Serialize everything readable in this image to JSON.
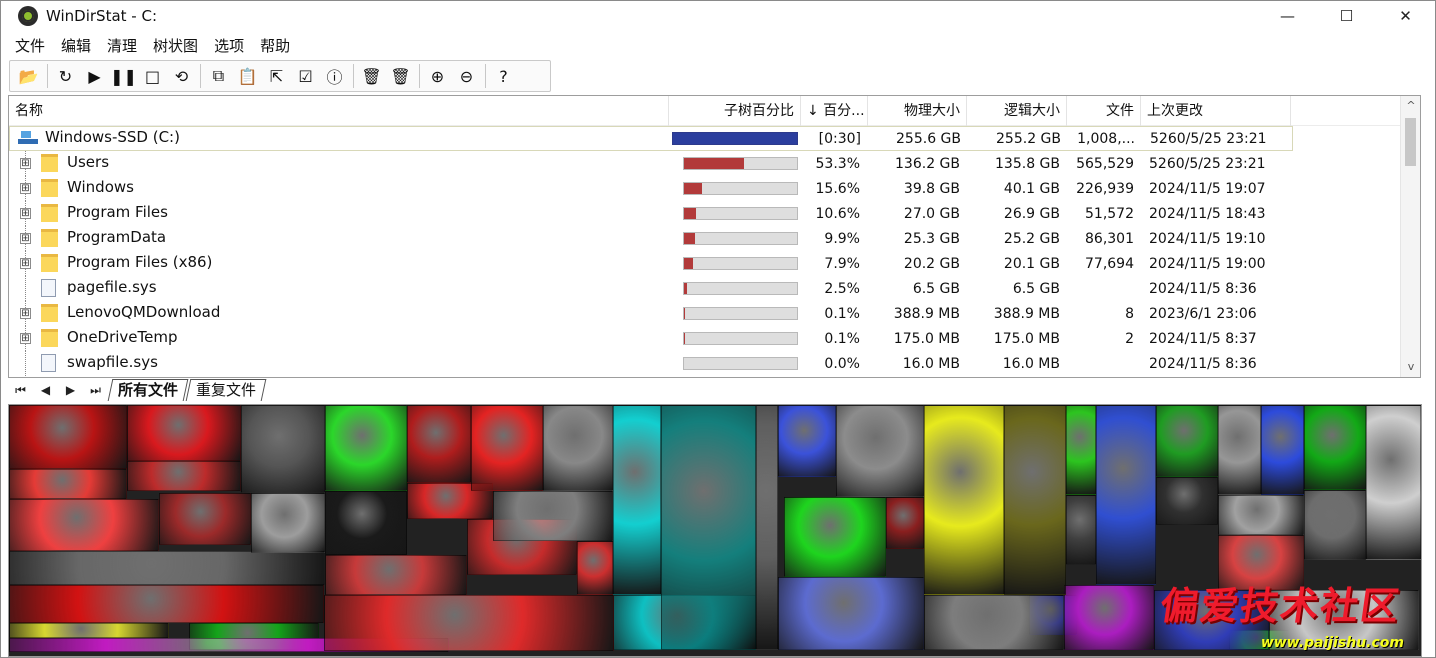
{
  "window": {
    "title": "WinDirStat - C:",
    "minimize": "—",
    "maximize": "☐",
    "close": "✕"
  },
  "menu": [
    "文件",
    "编辑",
    "清理",
    "树状图",
    "选项",
    "帮助"
  ],
  "toolbar": [
    {
      "name": "open-icon",
      "glyph": "📂"
    },
    {
      "sep": true
    },
    {
      "name": "refresh-icon",
      "glyph": "↻"
    },
    {
      "name": "play-icon",
      "glyph": "▶"
    },
    {
      "name": "pause-icon",
      "glyph": "❚❚"
    },
    {
      "name": "stop-icon",
      "glyph": "□"
    },
    {
      "name": "refresh-selected-icon",
      "glyph": "⟲"
    },
    {
      "sep": true
    },
    {
      "name": "copy-icon",
      "glyph": "⧉"
    },
    {
      "name": "paste-icon",
      "glyph": "📋"
    },
    {
      "name": "select-icon",
      "glyph": "⇱"
    },
    {
      "name": "properties-icon",
      "glyph": "☑"
    },
    {
      "name": "info-icon",
      "glyph": "ⓘ"
    },
    {
      "sep": true
    },
    {
      "name": "recycle-icon",
      "glyph": "🗑"
    },
    {
      "name": "delete-icon",
      "glyph": "🗑"
    },
    {
      "sep": true
    },
    {
      "name": "zoom-in-icon",
      "glyph": "⊕"
    },
    {
      "name": "zoom-out-icon",
      "glyph": "⊖"
    },
    {
      "sep": true
    },
    {
      "name": "help-icon",
      "glyph": "?"
    }
  ],
  "columns": {
    "name": "名称",
    "subtree": "子树百分比",
    "percent": "↓ 百分...",
    "physical": "物理大小",
    "logical": "逻辑大小",
    "files": "文件",
    "modified": "上次更改"
  },
  "rows": [
    {
      "name": "Windows-SSD (C:)",
      "type": "drive",
      "percent_text": "[0:30]",
      "physical": "255.6 GB",
      "logical": "255.2 GB",
      "files": "1,008,...",
      "modified": "5260/5/25  23:21",
      "bar": 1,
      "root": true
    },
    {
      "name": "Users",
      "type": "folder",
      "percent_text": "53.3%",
      "physical": "136.2 GB",
      "logical": "135.8 GB",
      "files": "565,529",
      "modified": "5260/5/25  23:21",
      "bar": 0.533
    },
    {
      "name": "Windows",
      "type": "folder",
      "percent_text": "15.6%",
      "physical": "39.8 GB",
      "logical": "40.1 GB",
      "files": "226,939",
      "modified": "2024/11/5  19:07",
      "bar": 0.156
    },
    {
      "name": "Program Files",
      "type": "folder",
      "percent_text": "10.6%",
      "physical": "27.0 GB",
      "logical": "26.9 GB",
      "files": "51,572",
      "modified": "2024/11/5  18:43",
      "bar": 0.106
    },
    {
      "name": "ProgramData",
      "type": "folder",
      "percent_text": "9.9%",
      "physical": "25.3 GB",
      "logical": "25.2 GB",
      "files": "86,301",
      "modified": "2024/11/5  19:10",
      "bar": 0.099
    },
    {
      "name": "Program Files (x86)",
      "type": "folder",
      "percent_text": "7.9%",
      "physical": "20.2 GB",
      "logical": "20.1 GB",
      "files": "77,694",
      "modified": "2024/11/5  19:00",
      "bar": 0.079
    },
    {
      "name": "pagefile.sys",
      "type": "file",
      "percent_text": "2.5%",
      "physical": "6.5 GB",
      "logical": "6.5 GB",
      "files": "",
      "modified": "2024/11/5  8:36",
      "bar": 0.025
    },
    {
      "name": "LenovoQMDownload",
      "type": "folder",
      "percent_text": "0.1%",
      "physical": "388.9 MB",
      "logical": "388.9 MB",
      "files": "8",
      "modified": "2023/6/1  23:06",
      "bar": 0.001
    },
    {
      "name": "OneDriveTemp",
      "type": "folder",
      "percent_text": "0.1%",
      "physical": "175.0 MB",
      "logical": "175.0 MB",
      "files": "2",
      "modified": "2024/11/5  8:37",
      "bar": 0.001
    },
    {
      "name": "swapfile.sys",
      "type": "file",
      "percent_text": "0.0%",
      "physical": "16.0 MB",
      "logical": "16.0 MB",
      "files": "",
      "modified": "2024/11/5  8:36",
      "bar": 0
    }
  ],
  "tabs": [
    "所有文件",
    "重复文件"
  ],
  "watermark": {
    "text": "偏爱技术社区",
    "url": "www.paijishu.com"
  },
  "colors": {
    "selected_bar": "#2b3e9e",
    "usage_bar": "#b23a3a",
    "folder": "#fbd75b"
  },
  "icon": {
    "expand": "⊞",
    "scroll_up": "^",
    "scroll_down": "v",
    "nav": [
      "⏮",
      "◀",
      "▶",
      "⏭"
    ]
  }
}
